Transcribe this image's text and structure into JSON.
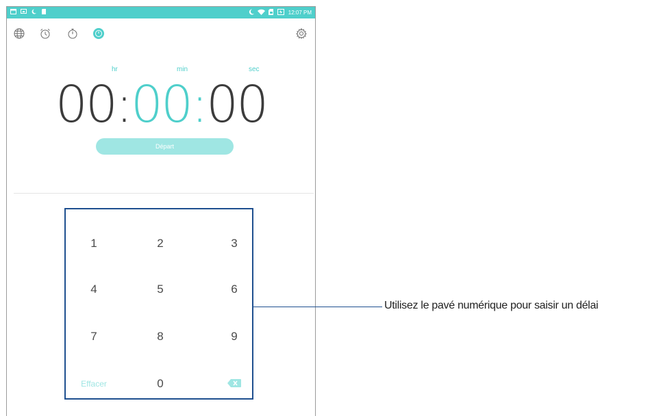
{
  "status_bar": {
    "time": "12:07 PM",
    "left_icons": [
      "notification-icon",
      "screen-icon",
      "moon-icon",
      "sd-card-icon"
    ],
    "right_icons": [
      "moon-icon",
      "wifi-icon",
      "sim-icon",
      "battery-charging-icon"
    ]
  },
  "toolbar": {
    "tabs": [
      {
        "name": "world-clock",
        "icon": "globe-icon"
      },
      {
        "name": "alarm",
        "icon": "alarm-clock-icon"
      },
      {
        "name": "stopwatch",
        "icon": "stopwatch-icon"
      },
      {
        "name": "timer",
        "icon": "timer-icon",
        "active": true
      }
    ],
    "settings_icon": "gear-icon"
  },
  "timer": {
    "hr_label": "hr",
    "min_label": "min",
    "sec_label": "sec",
    "hours": "00",
    "minutes": "00",
    "seconds": "00",
    "separator": ":",
    "start_label": "Départ"
  },
  "keypad": {
    "keys": [
      "1",
      "2",
      "3",
      "4",
      "5",
      "6",
      "7",
      "8",
      "9"
    ],
    "clear_label": "Effacer",
    "zero": "0",
    "backspace_icon": "backspace-icon"
  },
  "callout": {
    "text": "Utilisez le pavé numérique pour saisir un délai"
  },
  "colors": {
    "accent": "#4fcfcb",
    "accent_light": "#9fe6e3",
    "highlight_border": "#1e4f8f",
    "text": "#3c3c3c"
  }
}
